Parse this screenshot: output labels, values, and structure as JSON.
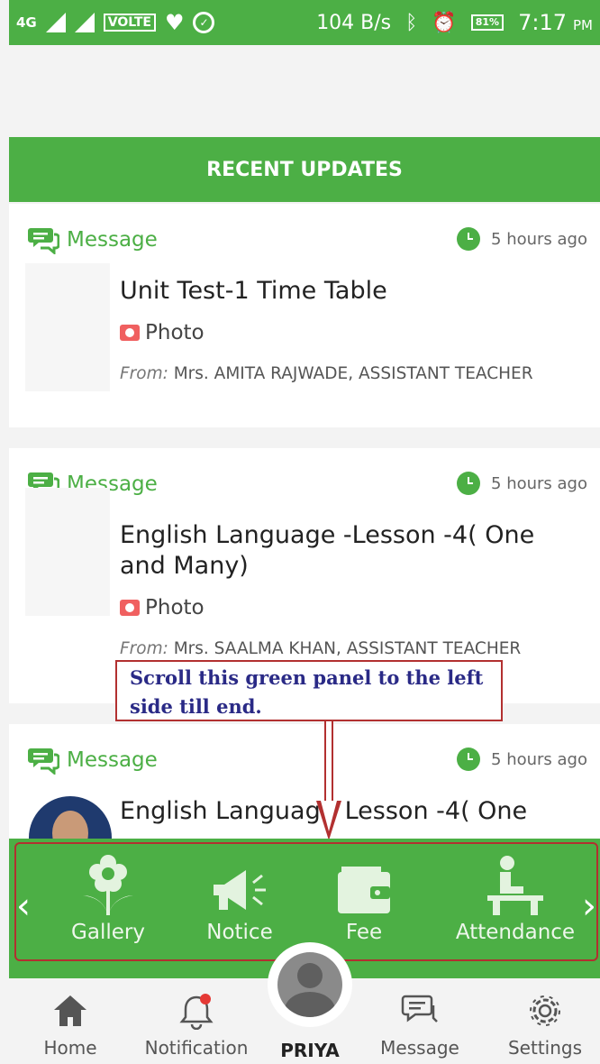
{
  "status_bar": {
    "network": "4G",
    "volte": "VOLTE",
    "speed": "104 B/s",
    "battery": "81%",
    "time": "7:17",
    "ampm": "PM"
  },
  "header": {
    "title": "RECENT UPDATES"
  },
  "cards": [
    {
      "type": "Message",
      "time": "5 hours ago",
      "title": "Unit Test-1 Time Table",
      "attachment": "Photo",
      "from_label": "From:",
      "from": "Mrs. AMITA RAJWADE, ASSISTANT TEACHER"
    },
    {
      "type": "Message",
      "time": "5 hours ago",
      "title": "English Language -Lesson -4( One and Many)",
      "attachment": "Photo",
      "from_label": "From:",
      "from": "Mrs. SAALMA KHAN, ASSISTANT TEACHER"
    },
    {
      "type": "Message",
      "time": "5 hours ago",
      "title": "English Languag - Lesson -4( One"
    }
  ],
  "callout": {
    "text": "Scroll this green panel to the left side till end."
  },
  "shortcuts": [
    {
      "label": "Gallery",
      "icon": "flower-icon"
    },
    {
      "label": "Notice",
      "icon": "megaphone-icon"
    },
    {
      "label": "Fee",
      "icon": "wallet-icon"
    },
    {
      "label": "Attendance",
      "icon": "attendance-icon"
    }
  ],
  "bottom_nav": {
    "home": "Home",
    "notification": "Notification",
    "profile": "PRIYA",
    "message": "Message",
    "settings": "Settings"
  },
  "colors": {
    "green": "#4caf45",
    "callout_border": "#b23030",
    "callout_text": "#2a2a86",
    "notify_dot": "#e53935"
  }
}
